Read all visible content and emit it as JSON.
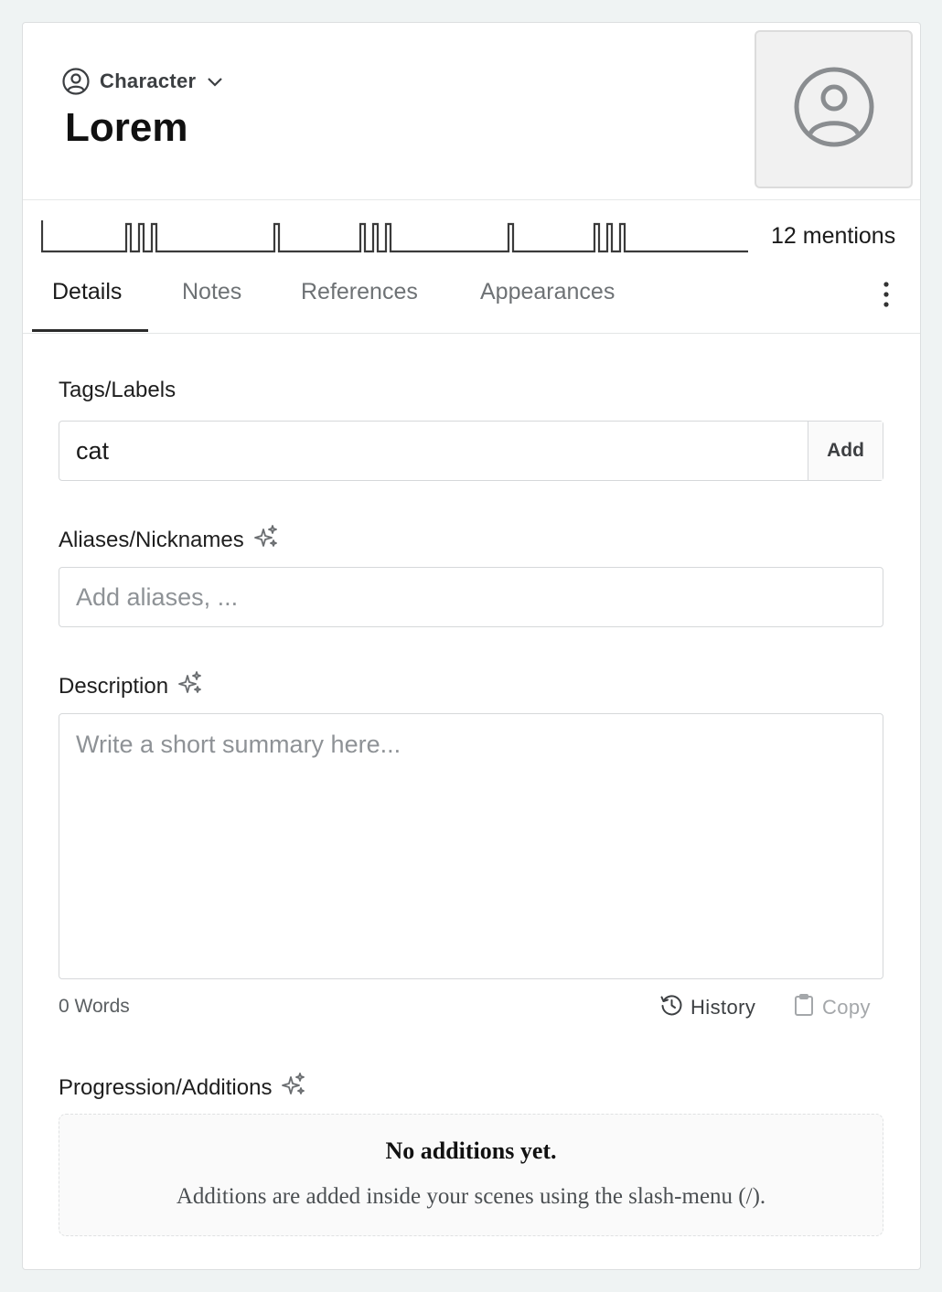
{
  "header": {
    "type_label": "Character",
    "entity_name": "Lorem"
  },
  "mentions": {
    "count_label": "12 mentions"
  },
  "tabs": [
    {
      "label": "Details",
      "active": true
    },
    {
      "label": "Notes",
      "active": false
    },
    {
      "label": "References",
      "active": false
    },
    {
      "label": "Appearances",
      "active": false
    }
  ],
  "fields": {
    "tags": {
      "label": "Tags/Labels",
      "value": "cat",
      "add_label": "Add"
    },
    "aliases": {
      "label": "Aliases/Nicknames",
      "placeholder": "Add aliases, ..."
    },
    "description": {
      "label": "Description",
      "placeholder": "Write a short summary here...",
      "word_count": "0 Words",
      "history_label": "History",
      "copy_label": "Copy"
    },
    "progression": {
      "label": "Progression/Additions",
      "empty_title": "No additions yet.",
      "empty_description": "Additions are added inside your scenes using the slash-menu (/)."
    }
  },
  "icons": {
    "type": "user-circle-icon",
    "dropdown": "chevron-down-icon",
    "avatar": "user-circle-icon",
    "more": "more-vertical-icon",
    "ai": "sparkles-icon",
    "history": "history-icon",
    "copy": "clipboard-icon"
  },
  "colors": {
    "background": "#eff3f3",
    "card": "#ffffff",
    "muted_text": "#6e7275",
    "border": "#d6d8da"
  }
}
